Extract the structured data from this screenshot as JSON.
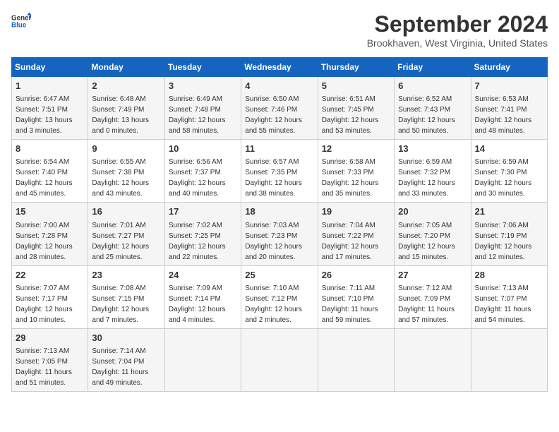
{
  "header": {
    "logo_line1": "General",
    "logo_line2": "Blue",
    "month": "September 2024",
    "location": "Brookhaven, West Virginia, United States"
  },
  "days_of_week": [
    "Sunday",
    "Monday",
    "Tuesday",
    "Wednesday",
    "Thursday",
    "Friday",
    "Saturday"
  ],
  "weeks": [
    [
      {
        "day": 1,
        "rise": "6:47 AM",
        "set": "7:51 PM",
        "daylight": "13 hours and 3 minutes."
      },
      {
        "day": 2,
        "rise": "6:48 AM",
        "set": "7:49 PM",
        "daylight": "13 hours and 0 minutes."
      },
      {
        "day": 3,
        "rise": "6:49 AM",
        "set": "7:48 PM",
        "daylight": "12 hours and 58 minutes."
      },
      {
        "day": 4,
        "rise": "6:50 AM",
        "set": "7:46 PM",
        "daylight": "12 hours and 55 minutes."
      },
      {
        "day": 5,
        "rise": "6:51 AM",
        "set": "7:45 PM",
        "daylight": "12 hours and 53 minutes."
      },
      {
        "day": 6,
        "rise": "6:52 AM",
        "set": "7:43 PM",
        "daylight": "12 hours and 50 minutes."
      },
      {
        "day": 7,
        "rise": "6:53 AM",
        "set": "7:41 PM",
        "daylight": "12 hours and 48 minutes."
      }
    ],
    [
      {
        "day": 8,
        "rise": "6:54 AM",
        "set": "7:40 PM",
        "daylight": "12 hours and 45 minutes."
      },
      {
        "day": 9,
        "rise": "6:55 AM",
        "set": "7:38 PM",
        "daylight": "12 hours and 43 minutes."
      },
      {
        "day": 10,
        "rise": "6:56 AM",
        "set": "7:37 PM",
        "daylight": "12 hours and 40 minutes."
      },
      {
        "day": 11,
        "rise": "6:57 AM",
        "set": "7:35 PM",
        "daylight": "12 hours and 38 minutes."
      },
      {
        "day": 12,
        "rise": "6:58 AM",
        "set": "7:33 PM",
        "daylight": "12 hours and 35 minutes."
      },
      {
        "day": 13,
        "rise": "6:59 AM",
        "set": "7:32 PM",
        "daylight": "12 hours and 33 minutes."
      },
      {
        "day": 14,
        "rise": "6:59 AM",
        "set": "7:30 PM",
        "daylight": "12 hours and 30 minutes."
      }
    ],
    [
      {
        "day": 15,
        "rise": "7:00 AM",
        "set": "7:28 PM",
        "daylight": "12 hours and 28 minutes."
      },
      {
        "day": 16,
        "rise": "7:01 AM",
        "set": "7:27 PM",
        "daylight": "12 hours and 25 minutes."
      },
      {
        "day": 17,
        "rise": "7:02 AM",
        "set": "7:25 PM",
        "daylight": "12 hours and 22 minutes."
      },
      {
        "day": 18,
        "rise": "7:03 AM",
        "set": "7:23 PM",
        "daylight": "12 hours and 20 minutes."
      },
      {
        "day": 19,
        "rise": "7:04 AM",
        "set": "7:22 PM",
        "daylight": "12 hours and 17 minutes."
      },
      {
        "day": 20,
        "rise": "7:05 AM",
        "set": "7:20 PM",
        "daylight": "12 hours and 15 minutes."
      },
      {
        "day": 21,
        "rise": "7:06 AM",
        "set": "7:19 PM",
        "daylight": "12 hours and 12 minutes."
      }
    ],
    [
      {
        "day": 22,
        "rise": "7:07 AM",
        "set": "7:17 PM",
        "daylight": "12 hours and 10 minutes."
      },
      {
        "day": 23,
        "rise": "7:08 AM",
        "set": "7:15 PM",
        "daylight": "12 hours and 7 minutes."
      },
      {
        "day": 24,
        "rise": "7:09 AM",
        "set": "7:14 PM",
        "daylight": "12 hours and 4 minutes."
      },
      {
        "day": 25,
        "rise": "7:10 AM",
        "set": "7:12 PM",
        "daylight": "12 hours and 2 minutes."
      },
      {
        "day": 26,
        "rise": "7:11 AM",
        "set": "7:10 PM",
        "daylight": "11 hours and 59 minutes."
      },
      {
        "day": 27,
        "rise": "7:12 AM",
        "set": "7:09 PM",
        "daylight": "11 hours and 57 minutes."
      },
      {
        "day": 28,
        "rise": "7:13 AM",
        "set": "7:07 PM",
        "daylight": "11 hours and 54 minutes."
      }
    ],
    [
      {
        "day": 29,
        "rise": "7:13 AM",
        "set": "7:05 PM",
        "daylight": "11 hours and 51 minutes."
      },
      {
        "day": 30,
        "rise": "7:14 AM",
        "set": "7:04 PM",
        "daylight": "11 hours and 49 minutes."
      },
      null,
      null,
      null,
      null,
      null
    ]
  ]
}
